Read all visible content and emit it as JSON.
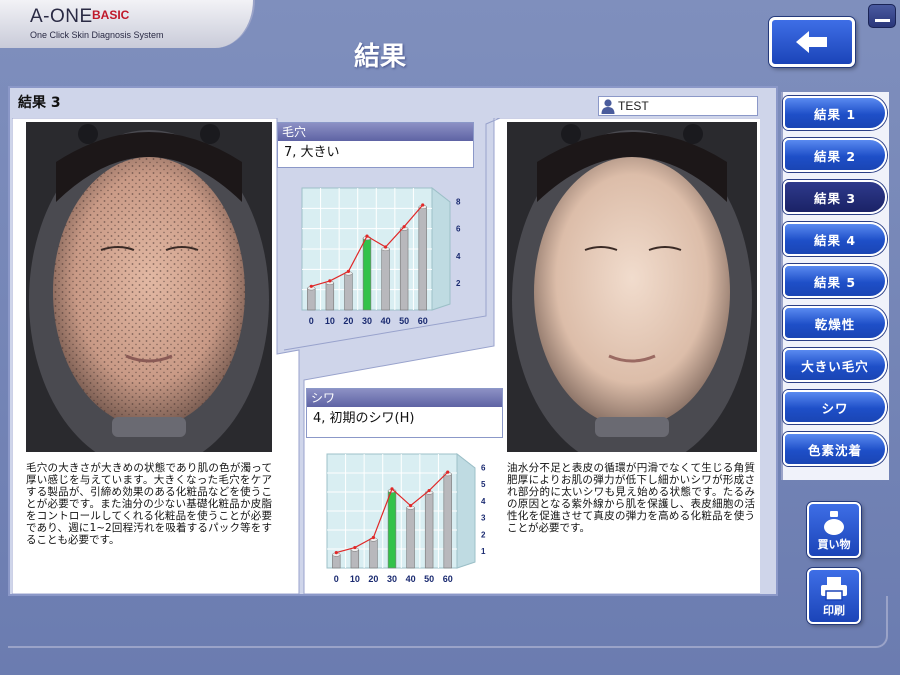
{
  "logo": {
    "brand": "A-ONE",
    "edition": "BASIC",
    "tagline": "One Click Skin Diagnosis System"
  },
  "page_title": "結果",
  "panel": {
    "caption": "結果 3",
    "user": "TEST"
  },
  "pores": {
    "header": "毛穴",
    "value": "7,  大きい",
    "description": "毛穴の大きさが大きめの状態であり肌の色が濁って厚い感じを与えています。大きくなった毛穴をケアする製品が、引締め効果のある化粧品などを使うことが必要です。また油分の少ない基礎化粧品か皮脂をコントロールしてくれる化粧品を使うことが必要であり、週に1~2回程汚れを吸着するパック等をすることも必要です。",
    "chart_data": {
      "type": "bar",
      "categories": [
        "0",
        "10",
        "20",
        "30",
        "40",
        "50",
        "60"
      ],
      "values": [
        1.6,
        2.0,
        2.7,
        5.3,
        4.5,
        6.0,
        7.6
      ],
      "highlight_index": 3,
      "y_ticks": [
        "2",
        "4",
        "6",
        "8"
      ],
      "ylim": [
        0,
        9
      ],
      "bar_color": "#b8b8bc",
      "highlight_color": "#33c24a",
      "trend_color": "#e02828"
    }
  },
  "wrinkles": {
    "header": "シワ",
    "value": "4,  初期のシワ(H)",
    "description": "油水分不足と表皮の循環が円滑でなくて生じる角質肥厚によりお肌の弾力が低下し細かいシワが形成され部分的に太いシワも見え始める状態です。たるみの原因となる紫外線から肌を保護し、表皮細胞の活性化を促進させて真皮の弾力を高める化粧品を使うことが必要です。",
    "chart_data": {
      "type": "bar",
      "categories": [
        "0",
        "10",
        "20",
        "30",
        "40",
        "50",
        "60"
      ],
      "values": [
        0.8,
        1.1,
        1.7,
        4.6,
        3.6,
        4.5,
        5.6
      ],
      "highlight_index": 3,
      "y_ticks": [
        "1",
        "2",
        "3",
        "4",
        "5",
        "6"
      ],
      "ylim": [
        0,
        6.8
      ],
      "bar_color": "#b8b8bc",
      "highlight_color": "#33c24a",
      "trend_color": "#e02828"
    }
  },
  "sidebar": {
    "items": [
      "結果 1",
      "結果 2",
      "結果 3",
      "結果 4",
      "結果 5",
      "乾燥性",
      "大きい毛穴",
      "シワ",
      "色素沈着"
    ],
    "active_index": 2
  },
  "actions": {
    "shop": "買い物",
    "print": "印刷"
  },
  "icons": {
    "back": "arrow-left-icon",
    "user": "person-icon",
    "shop": "perfume-bottle-icon",
    "print": "printer-icon",
    "minimize": "minimize-icon"
  }
}
